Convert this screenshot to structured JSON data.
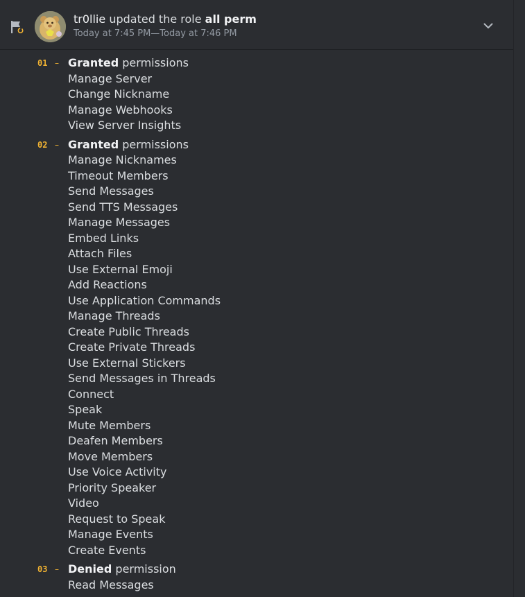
{
  "entry": {
    "username": "tr0llie",
    "action_text": "updated the role",
    "role_name": "all perm",
    "timestamp": "Today at 7:45 PM—Today at 7:46 PM",
    "icon": "flag-update-icon",
    "expand_icon": "chevron-down-icon"
  },
  "colors": {
    "background": "#2b2d31",
    "change_number": "#f0b232",
    "text": "#dbdee1",
    "muted": "#949ba4"
  },
  "changes": [
    {
      "number": "01",
      "dash": "–",
      "kind": "Granted",
      "label": "permissions",
      "items": [
        "Manage Server",
        "Change Nickname",
        "Manage Webhooks",
        "View Server Insights"
      ]
    },
    {
      "number": "02",
      "dash": "–",
      "kind": "Granted",
      "label": "permissions",
      "items": [
        "Manage Nicknames",
        "Timeout Members",
        "Send Messages",
        "Send TTS Messages",
        "Manage Messages",
        "Embed Links",
        "Attach Files",
        "Use External Emoji",
        "Add Reactions",
        "Use Application Commands",
        "Manage Threads",
        "Create Public Threads",
        "Create Private Threads",
        "Use External Stickers",
        "Send Messages in Threads",
        "Connect",
        "Speak",
        "Mute Members",
        "Deafen Members",
        "Move Members",
        "Use Voice Activity",
        "Priority Speaker",
        "Video",
        "Request to Speak",
        "Manage Events",
        "Create Events"
      ]
    },
    {
      "number": "03",
      "dash": "–",
      "kind": "Denied",
      "label": "permission",
      "items": [
        "Read Messages"
      ]
    }
  ]
}
